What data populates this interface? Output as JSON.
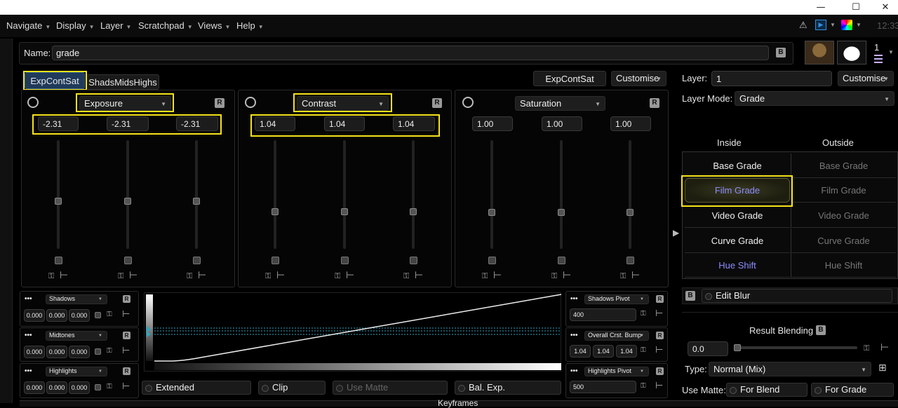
{
  "titlebar": {
    "minimize": "—",
    "maximize": "☐",
    "close": "✕"
  },
  "menu": [
    "Navigate",
    "Display",
    "Layer",
    "Scratchpad",
    "Views",
    "Help"
  ],
  "status": {
    "time": "12:33"
  },
  "name_field": {
    "label": "Name:",
    "value": "grade"
  },
  "top_tabs": [
    "ExpContSat",
    "ShadsMidsHighs"
  ],
  "preset_button": "ExpContSat",
  "customise": "Customise",
  "avatar_count": "1",
  "sections": [
    {
      "mode": "Exposure",
      "values": [
        "-2.31",
        "-2.31",
        "-2.31"
      ]
    },
    {
      "mode": "Contrast",
      "values": [
        "1.04",
        "1.04",
        "1.04"
      ]
    },
    {
      "mode": "Saturation",
      "values": [
        "1.00",
        "1.00",
        "1.00"
      ]
    }
  ],
  "bottom_left": [
    {
      "label": "Shadows",
      "values": [
        "0.000",
        "0.000",
        "0.000"
      ]
    },
    {
      "label": "Midtones",
      "values": [
        "0.000",
        "0.000",
        "0.000"
      ]
    },
    {
      "label": "Highlights",
      "values": [
        "0.000",
        "0.000",
        "0.000"
      ]
    }
  ],
  "bottom_right": [
    {
      "label": "Shadows Pivot",
      "values": [
        "400"
      ]
    },
    {
      "label": "Overall Crst. Bump",
      "values": [
        "1.04",
        "1.04",
        "1.04"
      ]
    },
    {
      "label": "Highlights Pivot",
      "values": [
        "500"
      ]
    }
  ],
  "bottom_buttons": [
    "Extended",
    "Clip",
    "Use Matte",
    "Bal. Exp."
  ],
  "keyframes": "Keyframes",
  "layer": {
    "label": "Layer:",
    "value": "1",
    "mode_label": "Layer Mode:",
    "mode_value": "Grade"
  },
  "grade_columns": {
    "inside": "Inside",
    "outside": "Outside"
  },
  "grade_items": [
    "Base Grade",
    "Film Grade",
    "Video Grade",
    "Curve Grade",
    "Hue Shift"
  ],
  "edit_blur": "Edit Blur",
  "result_blending": {
    "title": "Result Blending",
    "value": "0.0"
  },
  "type": {
    "label": "Type:",
    "value": "Normal (Mix)"
  },
  "use_matte": {
    "label": "Use Matte:",
    "for_blend": "For Blend",
    "for_grade": "For Grade"
  },
  "icons": {
    "r_button": "R",
    "b_button": "B",
    "dots": "•••"
  },
  "colors": {
    "highlight": "#f5e31a",
    "accent_text": "#8c8cff",
    "active_tab": "#1f3a5a"
  }
}
